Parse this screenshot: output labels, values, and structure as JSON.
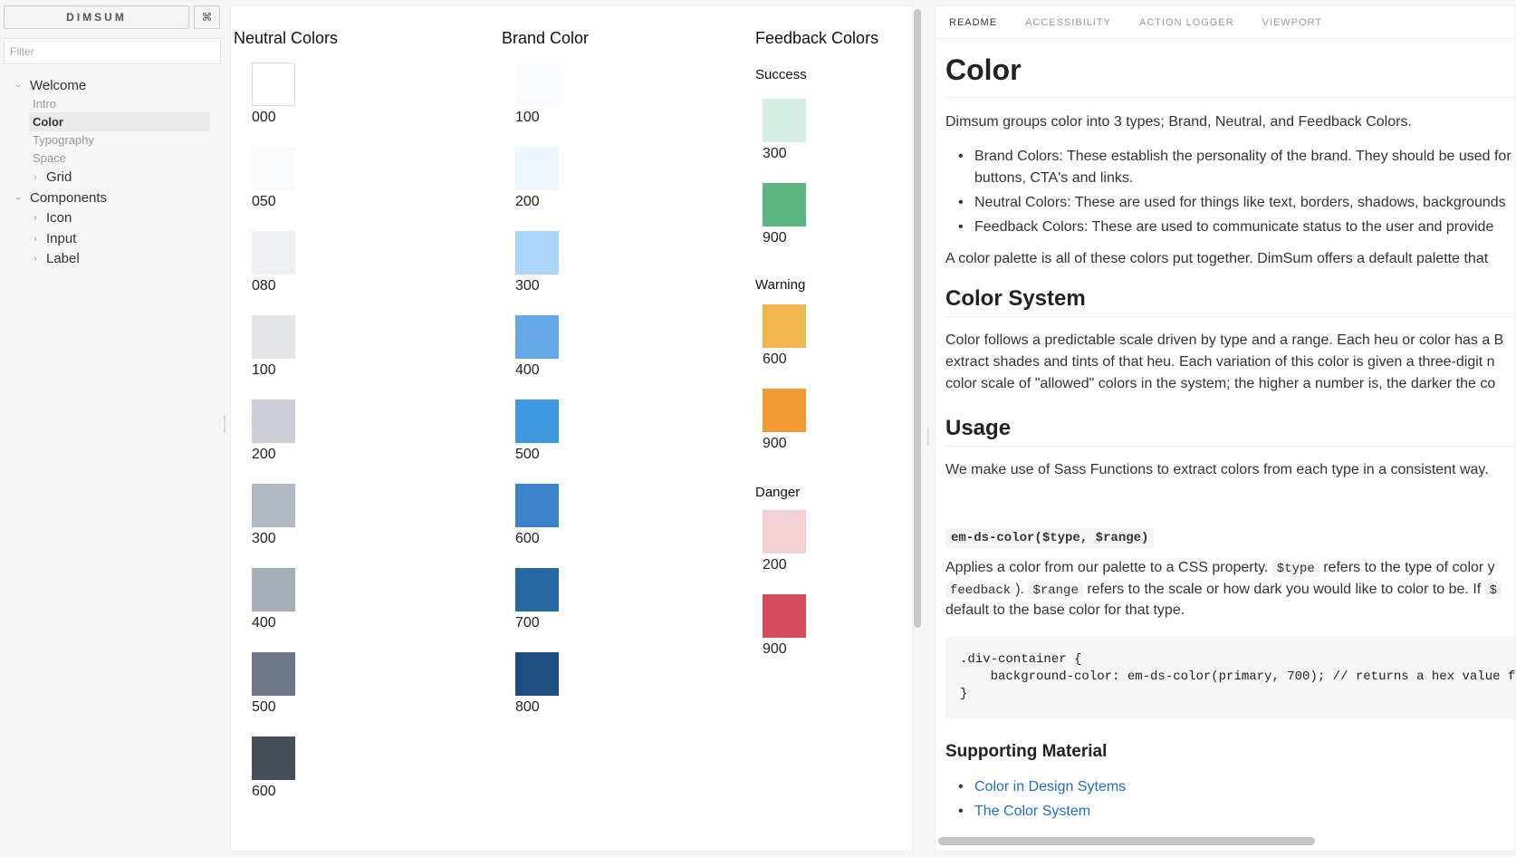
{
  "sidebar": {
    "brand": "DIMSUM",
    "shortcut": "⌘",
    "filter_placeholder": "Filter",
    "tree": {
      "welcome": "Welcome",
      "intro": "Intro",
      "color": "Color",
      "typography": "Typography",
      "space": "Space",
      "grid": "Grid",
      "components": "Components",
      "icon": "Icon",
      "input": "Input",
      "label": "Label"
    },
    "chevron_expanded": "›",
    "chevron_collapsed": "›"
  },
  "preview": {
    "neutral_title": "Neutral Colors",
    "brand_title": "Brand Color",
    "feedback_title": "Feedback Colors",
    "neutral": [
      {
        "label": "000",
        "color": "#ffffff"
      },
      {
        "label": "050",
        "color": "#f8f9fb"
      },
      {
        "label": "080",
        "color": "#eeeff2"
      },
      {
        "label": "100",
        "color": "#e2e4e8"
      },
      {
        "label": "200",
        "color": "#cbced5"
      },
      {
        "label": "300",
        "color": "#b2b8c4"
      },
      {
        "label": "400",
        "color": "#a7adb8"
      },
      {
        "label": "500",
        "color": "#6d7587"
      },
      {
        "label": "600",
        "color": "#464d58"
      }
    ],
    "brand": [
      {
        "label": "100",
        "color": "#f8fbff"
      },
      {
        "label": "200",
        "color": "#eef5fe"
      },
      {
        "label": "300",
        "color": "#acd5fb"
      },
      {
        "label": "400",
        "color": "#65a8e7"
      },
      {
        "label": "500",
        "color": "#3e98e0"
      },
      {
        "label": "600",
        "color": "#3b82c8"
      },
      {
        "label": "700",
        "color": "#2668a5"
      },
      {
        "label": "800",
        "color": "#1b4d7e"
      }
    ],
    "feedback": {
      "success_title": "Success",
      "warning_title": "Warning",
      "danger_title": "Danger",
      "success": [
        {
          "label": "300",
          "color": "#d6ede4"
        },
        {
          "label": "900",
          "color": "#5cb682"
        }
      ],
      "warning": [
        {
          "label": "600",
          "color": "#efb54f"
        },
        {
          "label": "900",
          "color": "#f19a36"
        }
      ],
      "danger": [
        {
          "label": "200",
          "color": "#f1cfd4"
        },
        {
          "label": "900",
          "color": "#d24e5c"
        }
      ]
    }
  },
  "addons": {
    "tabs": [
      "README",
      "ACCESSIBILITY",
      "ACTION LOGGER",
      "VIEWPORT"
    ],
    "readme": {
      "title": "Color",
      "intro": "Dimsum groups color into 3 types; Brand, Neutral, and Feedback Colors.",
      "bullets": [
        "Brand Colors: These establish the personality of the brand. They should be used for",
        "buttons, CTA's and links.",
        "Neutral Colors: These are used for things like text, borders, shadows, backgrounds",
        "Feedback Colors: These are used to communicate status to the user and provide"
      ],
      "palette_text": "A color palette is all of these colors put together. DimSum offers a default palette that",
      "h_system": "Color System",
      "system_lines": [
        "Color follows a predictable scale driven by type and a range. Each heu or color has a B",
        "extract shades and tints of that heu. Each variation of this color is given a three-digit n",
        "color scale of \"allowed\" colors in the system; the higher a number is, the darker the co"
      ],
      "h_usage": "Usage",
      "usage_text": "We make use of Sass Functions to extract colors from each type in a consistent way.",
      "signature": "em-ds-color($type, $range)",
      "applies_1a": "Applies a color from our palette to a CSS property.",
      "applies_1_code": "$type",
      "applies_1b": "refers to the type of color y",
      "applies_2_code_a": "feedback",
      "applies_2a": ").",
      "applies_2_code_b": "$range",
      "applies_2b": "refers to the scale or how dark you would like to color to be. If",
      "applies_2_code_c": "$",
      "applies_3": "default to the base color for that type.",
      "code_block": ".div-container {\n    background-color: em-ds-color(primary, 700); // returns a hex value fo\n}",
      "h_supporting": "Supporting Material",
      "links": [
        "Color in Design Sytems",
        "The Color System"
      ]
    }
  }
}
